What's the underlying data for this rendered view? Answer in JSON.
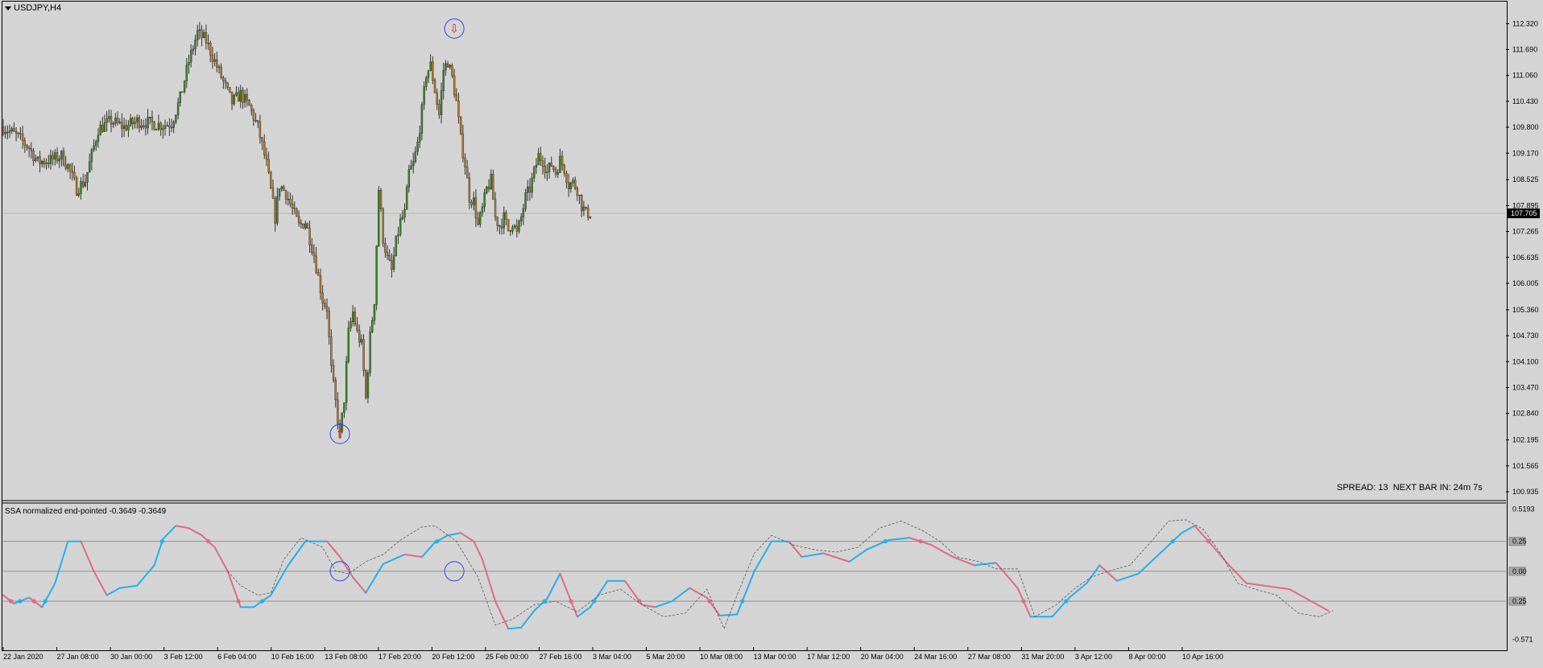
{
  "window": {
    "title": "USDJPY,H4",
    "indicator_title": "SSA normalized end-pointed -0.3649 -0.3649",
    "status_text": "SPREAD: 13  NEXT BAR IN: 24m 7s"
  },
  "colors": {
    "background": "#d4d4d4",
    "candle_up": "#3a8a26",
    "candle_down": "#b87a2a",
    "candle_wick": "#333333",
    "ssa_up": "#22b0ee",
    "ssa_down": "#e06a84",
    "signal_ring": "#3344ee",
    "arrow": "#dd2222",
    "grid": "#909090"
  },
  "icons": {
    "buy_signal": "arrow-up-icon",
    "sell_signal": "arrow-down-icon"
  },
  "chart_data": [
    {
      "type": "candlestick",
      "symbol": "USDJPY",
      "timeframe": "H4",
      "ylim": [
        100.935,
        112.62
      ],
      "y_ticks": [
        "112.320",
        "111.690",
        "111.060",
        "110.430",
        "109.800",
        "109.170",
        "108.525",
        "107.895",
        "107.265",
        "106.635",
        "106.005",
        "105.360",
        "104.730",
        "104.100",
        "103.470",
        "102.840",
        "102.195",
        "101.565",
        "100.935"
      ],
      "current_price": "107.705",
      "x_ticks": [
        "22 Jan 2020",
        "27 Jan 08:00",
        "30 Jan 00:00",
        "3 Feb 12:00",
        "6 Feb 04:00",
        "10 Feb 16:00",
        "13 Feb 08:00",
        "17 Feb 20:00",
        "20 Feb 12:00",
        "25 Feb 00:00",
        "27 Feb 16:00",
        "3 Mar 04:00",
        "5 Mar 20:00",
        "10 Mar 08:00",
        "13 Mar 00:00",
        "17 Mar 12:00",
        "20 Mar 04:00",
        "24 Mar 16:00",
        "27 Mar 08:00",
        "31 Mar 20:00",
        "3 Apr 12:00",
        "8 Apr 00:00",
        "10 Apr 16:00"
      ],
      "close_path": [
        [
          0,
          109.8
        ],
        [
          6,
          109.6
        ],
        [
          12,
          109.3
        ],
        [
          16,
          108.95
        ],
        [
          22,
          109.0
        ],
        [
          27,
          109.1
        ],
        [
          30,
          108.85
        ],
        [
          34,
          108.3
        ],
        [
          38,
          108.5
        ],
        [
          44,
          109.75
        ],
        [
          50,
          109.95
        ],
        [
          56,
          109.8
        ],
        [
          62,
          109.95
        ],
        [
          68,
          109.9
        ],
        [
          74,
          109.85
        ],
        [
          78,
          109.9
        ],
        [
          82,
          110.5
        ],
        [
          86,
          111.4
        ],
        [
          90,
          112.1
        ],
        [
          94,
          111.9
        ],
        [
          98,
          111.4
        ],
        [
          102,
          110.9
        ],
        [
          106,
          110.4
        ],
        [
          110,
          110.6
        ],
        [
          114,
          110.3
        ],
        [
          118,
          109.8
        ],
        [
          122,
          108.9
        ],
        [
          126,
          107.6
        ],
        [
          128,
          108.4
        ],
        [
          131,
          108.2
        ],
        [
          134,
          107.8
        ],
        [
          137,
          107.4
        ],
        [
          140,
          107.5
        ],
        [
          144,
          106.7
        ],
        [
          148,
          105.6
        ],
        [
          150,
          105.4
        ],
        [
          152,
          103.9
        ],
        [
          154,
          103.1
        ],
        [
          156,
          102.3
        ],
        [
          158,
          103.2
        ],
        [
          160,
          104.8
        ],
        [
          162,
          105.3
        ],
        [
          164,
          104.8
        ],
        [
          166,
          104.5
        ],
        [
          168,
          103.2
        ],
        [
          170,
          104.7
        ],
        [
          172,
          105.6
        ],
        [
          174,
          108.3
        ],
        [
          176,
          107.1
        ],
        [
          178,
          106.6
        ],
        [
          180,
          106.3
        ],
        [
          182,
          107.0
        ],
        [
          184,
          107.5
        ],
        [
          186,
          107.7
        ],
        [
          188,
          108.7
        ],
        [
          190,
          108.9
        ],
        [
          192,
          109.4
        ],
        [
          194,
          110.2
        ],
        [
          196,
          111.1
        ],
        [
          198,
          111.3
        ],
        [
          200,
          110.7
        ],
        [
          202,
          110.1
        ],
        [
          204,
          111.2
        ],
        [
          206,
          111.4
        ],
        [
          208,
          111.0
        ],
        [
          210,
          110.4
        ],
        [
          212,
          109.5
        ],
        [
          214,
          108.9
        ],
        [
          216,
          108.1
        ],
        [
          218,
          108.0
        ],
        [
          220,
          107.4
        ],
        [
          222,
          107.8
        ],
        [
          224,
          108.3
        ],
        [
          226,
          108.5
        ],
        [
          228,
          107.6
        ],
        [
          230,
          107.4
        ],
        [
          232,
          107.6
        ],
        [
          234,
          107.3
        ],
        [
          236,
          107.5
        ],
        [
          238,
          107.2
        ],
        [
          240,
          107.6
        ],
        [
          242,
          108.1
        ],
        [
          244,
          108.3
        ],
        [
          246,
          108.7
        ],
        [
          248,
          109.1
        ],
        [
          250,
          109.0
        ],
        [
          252,
          108.7
        ],
        [
          254,
          108.9
        ],
        [
          256,
          108.7
        ],
        [
          258,
          109.0
        ],
        [
          260,
          108.8
        ],
        [
          262,
          108.4
        ],
        [
          264,
          108.45
        ],
        [
          266,
          108.3
        ],
        [
          268,
          107.9
        ],
        [
          270,
          107.7
        ],
        [
          272,
          107.72
        ]
      ],
      "events": [
        {
          "label": "buy",
          "bar": 156,
          "price": 102.34
        },
        {
          "label": "sell",
          "bar": 209,
          "price": 112.2
        }
      ]
    },
    {
      "type": "line",
      "name": "SSA normalized end-pointed",
      "ylim": [
        -0.62,
        0.55
      ],
      "y_ticks": [
        "0.5193",
        "0.25",
        "0.00",
        "0.25",
        "-0.571"
      ],
      "levels": [
        0.25,
        0.0,
        -0.25
      ],
      "series": [
        {
          "role": "ssa",
          "values": [
            [
              0,
              -0.2
            ],
            [
              5,
              -0.27
            ],
            [
              12,
              -0.22
            ],
            [
              18,
              -0.3
            ],
            [
              24,
              -0.1
            ],
            [
              30,
              0.25
            ],
            [
              36,
              0.25
            ],
            [
              42,
              0.0
            ],
            [
              48,
              -0.2
            ],
            [
              54,
              -0.14
            ],
            [
              62,
              -0.12
            ],
            [
              70,
              0.05
            ],
            [
              74,
              0.27
            ],
            [
              80,
              0.38
            ],
            [
              86,
              0.36
            ],
            [
              92,
              0.3
            ],
            [
              98,
              0.2
            ],
            [
              104,
              0.0
            ],
            [
              110,
              -0.3
            ],
            [
              116,
              -0.3
            ],
            [
              124,
              -0.2
            ],
            [
              132,
              0.05
            ],
            [
              140,
              0.25
            ],
            [
              150,
              0.25
            ],
            [
              156,
              0.12
            ],
            [
              162,
              -0.05
            ],
            [
              168,
              -0.18
            ],
            [
              176,
              0.06
            ],
            [
              186,
              0.14
            ],
            [
              194,
              0.12
            ],
            [
              200,
              0.24
            ],
            [
              206,
              0.3
            ],
            [
              212,
              0.32
            ],
            [
              218,
              0.25
            ],
            [
              222,
              0.1
            ],
            [
              228,
              -0.25
            ],
            [
              234,
              -0.48
            ],
            [
              240,
              -0.47
            ],
            [
              246,
              -0.33
            ],
            [
              252,
              -0.23
            ],
            [
              258,
              -0.02
            ],
            [
              266,
              -0.38
            ],
            [
              272,
              -0.3
            ],
            [
              280,
              -0.08
            ],
            [
              288,
              -0.08
            ],
            [
              296,
              -0.28
            ],
            [
              302,
              -0.3
            ],
            [
              310,
              -0.25
            ],
            [
              318,
              -0.14
            ],
            [
              326,
              -0.22
            ],
            [
              332,
              -0.37
            ],
            [
              340,
              -0.36
            ],
            [
              348,
              0.0
            ],
            [
              356,
              0.25
            ],
            [
              364,
              0.25
            ],
            [
              370,
              0.12
            ],
            [
              380,
              0.15
            ],
            [
              392,
              0.08
            ],
            [
              400,
              0.18
            ],
            [
              410,
              0.26
            ],
            [
              420,
              0.28
            ],
            [
              430,
              0.22
            ],
            [
              440,
              0.12
            ],
            [
              450,
              0.05
            ],
            [
              460,
              0.07
            ],
            [
              470,
              -0.14
            ],
            [
              476,
              -0.38
            ],
            [
              486,
              -0.38
            ],
            [
              494,
              -0.22
            ],
            [
              502,
              -0.1
            ],
            [
              508,
              0.05
            ],
            [
              516,
              -0.08
            ],
            [
              526,
              -0.02
            ],
            [
              536,
              0.15
            ],
            [
              546,
              0.32
            ],
            [
              552,
              0.38
            ],
            [
              558,
              0.26
            ],
            [
              568,
              0.05
            ],
            [
              576,
              -0.1
            ],
            [
              584,
              -0.12
            ],
            [
              596,
              -0.15
            ],
            [
              606,
              -0.25
            ],
            [
              614,
              -0.33
            ]
          ]
        },
        {
          "role": "signal",
          "values": [
            [
              104,
              0.0
            ],
            [
              110,
              -0.12
            ],
            [
              118,
              -0.2
            ],
            [
              124,
              -0.18
            ],
            [
              130,
              0.1
            ],
            [
              138,
              0.28
            ],
            [
              148,
              0.2
            ],
            [
              154,
              0.0
            ],
            [
              160,
              -0.02
            ],
            [
              168,
              0.08
            ],
            [
              176,
              0.14
            ],
            [
              184,
              0.26
            ],
            [
              194,
              0.37
            ],
            [
              200,
              0.38
            ],
            [
              210,
              0.25
            ],
            [
              220,
              -0.05
            ],
            [
              228,
              -0.45
            ],
            [
              236,
              -0.4
            ],
            [
              246,
              -0.28
            ],
            [
              256,
              -0.25
            ],
            [
              266,
              -0.34
            ],
            [
              276,
              -0.2
            ],
            [
              286,
              -0.15
            ],
            [
              296,
              -0.28
            ],
            [
              306,
              -0.38
            ],
            [
              316,
              -0.35
            ],
            [
              326,
              -0.15
            ],
            [
              334,
              -0.48
            ],
            [
              340,
              -0.2
            ],
            [
              348,
              0.15
            ],
            [
              356,
              0.3
            ],
            [
              366,
              0.22
            ],
            [
              376,
              0.18
            ],
            [
              386,
              0.16
            ],
            [
              396,
              0.2
            ],
            [
              406,
              0.36
            ],
            [
              416,
              0.42
            ],
            [
              426,
              0.34
            ],
            [
              434,
              0.25
            ],
            [
              442,
              0.12
            ],
            [
              452,
              0.08
            ],
            [
              460,
              0.02
            ],
            [
              470,
              0.02
            ],
            [
              478,
              -0.38
            ],
            [
              488,
              -0.28
            ],
            [
              496,
              -0.15
            ],
            [
              504,
              -0.05
            ],
            [
              512,
              0.0
            ],
            [
              522,
              0.05
            ],
            [
              532,
              0.25
            ],
            [
              540,
              0.42
            ],
            [
              548,
              0.43
            ],
            [
              556,
              0.35
            ],
            [
              564,
              0.15
            ],
            [
              572,
              -0.1
            ],
            [
              580,
              -0.15
            ],
            [
              590,
              -0.2
            ],
            [
              600,
              -0.35
            ],
            [
              610,
              -0.38
            ],
            [
              616,
              -0.33
            ]
          ]
        }
      ]
    }
  ]
}
